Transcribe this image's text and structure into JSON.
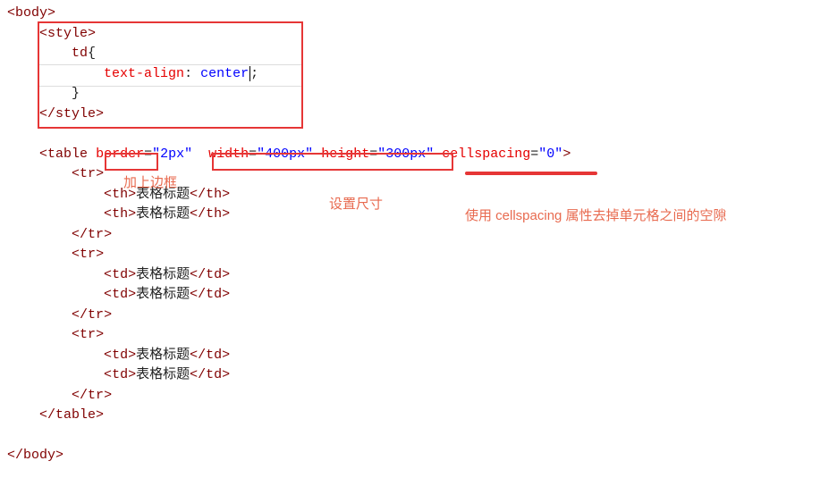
{
  "code": {
    "body_open": "body",
    "style_open": "style",
    "td_sel": "td",
    "text_align_prop": "text-align",
    "text_align_val": "center",
    "style_close": "style",
    "table_open": "table",
    "border_attr": "border",
    "border_val": "\"2px\"",
    "width_attr": "width",
    "width_val": "\"400px\"",
    "height_attr": "height",
    "height_val": "\"300px\"",
    "cellspacing_attr": "cellspacing",
    "cellspacing_val": "\"0\"",
    "tr": "tr",
    "th": "th",
    "td": "td",
    "cell_text": "表格标题",
    "table_close": "table",
    "body_close": "body"
  },
  "annotations": {
    "border_label": "加上边框",
    "size_label": "设置尺寸",
    "cellspacing_label": "使用 cellspacing 属性去掉单元格之间的空隙"
  }
}
